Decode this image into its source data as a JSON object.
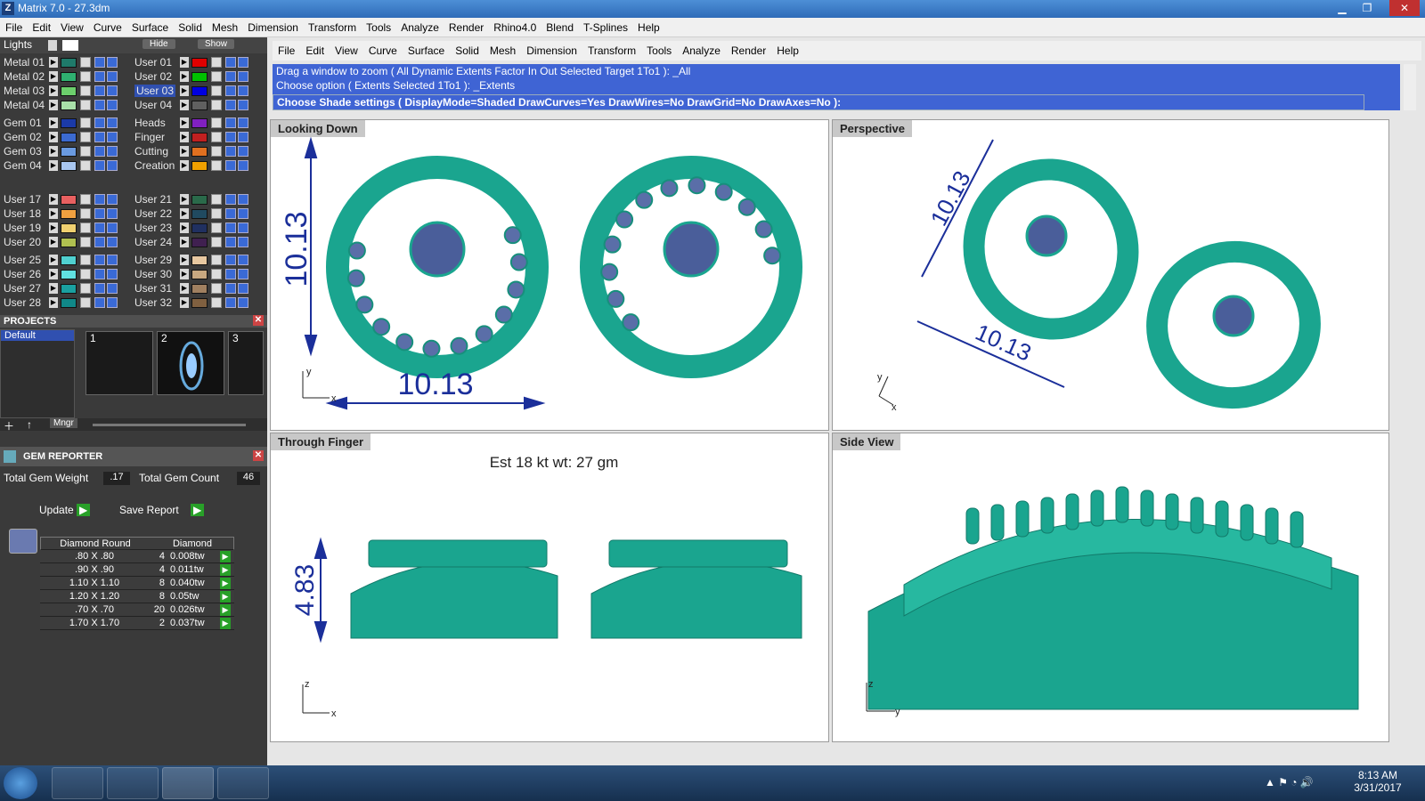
{
  "window": {
    "title": "Matrix 7.0 - 27.3dm",
    "app_icon": "Z"
  },
  "main_menu": [
    "File",
    "Edit",
    "View",
    "Curve",
    "Surface",
    "Solid",
    "Mesh",
    "Dimension",
    "Transform",
    "Tools",
    "Analyze",
    "Render",
    "Rhino4.0",
    "Blend",
    "T-Splines",
    "Help"
  ],
  "layers": {
    "header": {
      "lights": "Lights",
      "hide": "Hide",
      "show": "Show"
    },
    "left_col": [
      {
        "name": "Metal 01",
        "color": "#1f7a6a"
      },
      {
        "name": "Metal 02",
        "color": "#2fb070"
      },
      {
        "name": "Metal 03",
        "color": "#6ccf6c"
      },
      {
        "name": "Metal 04",
        "color": "#a8e0a8"
      },
      {
        "name": "Gem 01",
        "color": "#1b3aa8"
      },
      {
        "name": "Gem 02",
        "color": "#3b6ad0"
      },
      {
        "name": "Gem 03",
        "color": "#6a9ae0"
      },
      {
        "name": "Gem 04",
        "color": "#a8c6f0"
      },
      {
        "name": "User 17",
        "color": "#e86060"
      },
      {
        "name": "User 18",
        "color": "#f0a040"
      },
      {
        "name": "User 19",
        "color": "#f0d070"
      },
      {
        "name": "User 20",
        "color": "#b0c050"
      },
      {
        "name": "User 25",
        "color": "#50d0d0"
      },
      {
        "name": "User 26",
        "color": "#60e0e0"
      },
      {
        "name": "User 27",
        "color": "#1aa0a0"
      },
      {
        "name": "User 28",
        "color": "#108888"
      }
    ],
    "right_col": [
      {
        "name": "User 01",
        "color": "#e00000"
      },
      {
        "name": "User 02",
        "color": "#00c000"
      },
      {
        "name": "User 03",
        "color": "#0000e0",
        "selected": true
      },
      {
        "name": "User 04",
        "color": "#606060"
      },
      {
        "name": "Heads",
        "color": "#8020c0"
      },
      {
        "name": "Finger",
        "color": "#c02020"
      },
      {
        "name": "Cutting",
        "color": "#e07020"
      },
      {
        "name": "Creation",
        "color": "#f0a000"
      },
      {
        "name": "User 21",
        "color": "#2a6a4a"
      },
      {
        "name": "User 22",
        "color": "#204a60"
      },
      {
        "name": "User 23",
        "color": "#203060"
      },
      {
        "name": "User 24",
        "color": "#402050"
      },
      {
        "name": "User 29",
        "color": "#e8c8a0"
      },
      {
        "name": "User 30",
        "color": "#c8a880"
      },
      {
        "name": "User 31",
        "color": "#a08060"
      },
      {
        "name": "User 32",
        "color": "#806040"
      }
    ]
  },
  "projects": {
    "title": "PROJECTS",
    "items": [
      "Default"
    ],
    "thumbs": [
      "1",
      "2",
      "3"
    ],
    "mngr": "Mngr"
  },
  "gem_reporter": {
    "title": "GEM REPORTER",
    "total_weight_label": "Total Gem Weight",
    "total_weight": ".17",
    "total_count_label": "Total Gem Count",
    "total_count": "46",
    "update": "Update",
    "save_report": "Save Report",
    "col1": "Diamond Round",
    "col2": "Diamond",
    "rows": [
      {
        "size": ".80 X .80",
        "count": "4",
        "tw": "0.008tw"
      },
      {
        "size": ".90 X .90",
        "count": "4",
        "tw": "0.011tw"
      },
      {
        "size": "1.10 X 1.10",
        "count": "8",
        "tw": "0.040tw"
      },
      {
        "size": "1.20 X 1.20",
        "count": "8",
        "tw": "0.05tw"
      },
      {
        "size": ".70 X .70",
        "count": "20",
        "tw": "0.026tw"
      },
      {
        "size": "1.70 X 1.70",
        "count": "2",
        "tw": "0.037tw"
      }
    ]
  },
  "rhino_menu": [
    "File",
    "Edit",
    "View",
    "Curve",
    "Surface",
    "Solid",
    "Mesh",
    "Dimension",
    "Transform",
    "Tools",
    "Analyze",
    "Render",
    "Help"
  ],
  "command": {
    "line1": "Drag a window to zoom ( All  Dynamic  Extents  Factor  In  Out  Selected  Target  1To1 ): _All",
    "line2": "Choose option ( Extents  Selected  1To1 ): _Extents",
    "prompt": "Choose Shade settings ( DisplayMode=Shaded  DrawCurves=Yes  DrawWires=No  DrawGrid=No  DrawAxes=No ):"
  },
  "viewports": {
    "top_left": {
      "label": "Looking Down",
      "dim_v": "10.13",
      "dim_h": "10.13"
    },
    "top_right": {
      "label": "Perspective",
      "dim_a": "10.13",
      "dim_b": "10.13"
    },
    "bottom_left": {
      "label": "Through Finger",
      "note": "Est 18 kt wt: 27 gm",
      "dim": "4.83"
    },
    "bottom_right": {
      "label": "Side View"
    }
  },
  "axes": {
    "x": "x",
    "y": "y",
    "z": "z"
  },
  "clock": {
    "time": "8:13 AM",
    "date": "3/31/2017"
  },
  "colors": {
    "metal": "#1aa58f",
    "gem": "#4a5e9a",
    "cmd_bg": "#3f64d4",
    "dim": "#1b2f9a"
  }
}
